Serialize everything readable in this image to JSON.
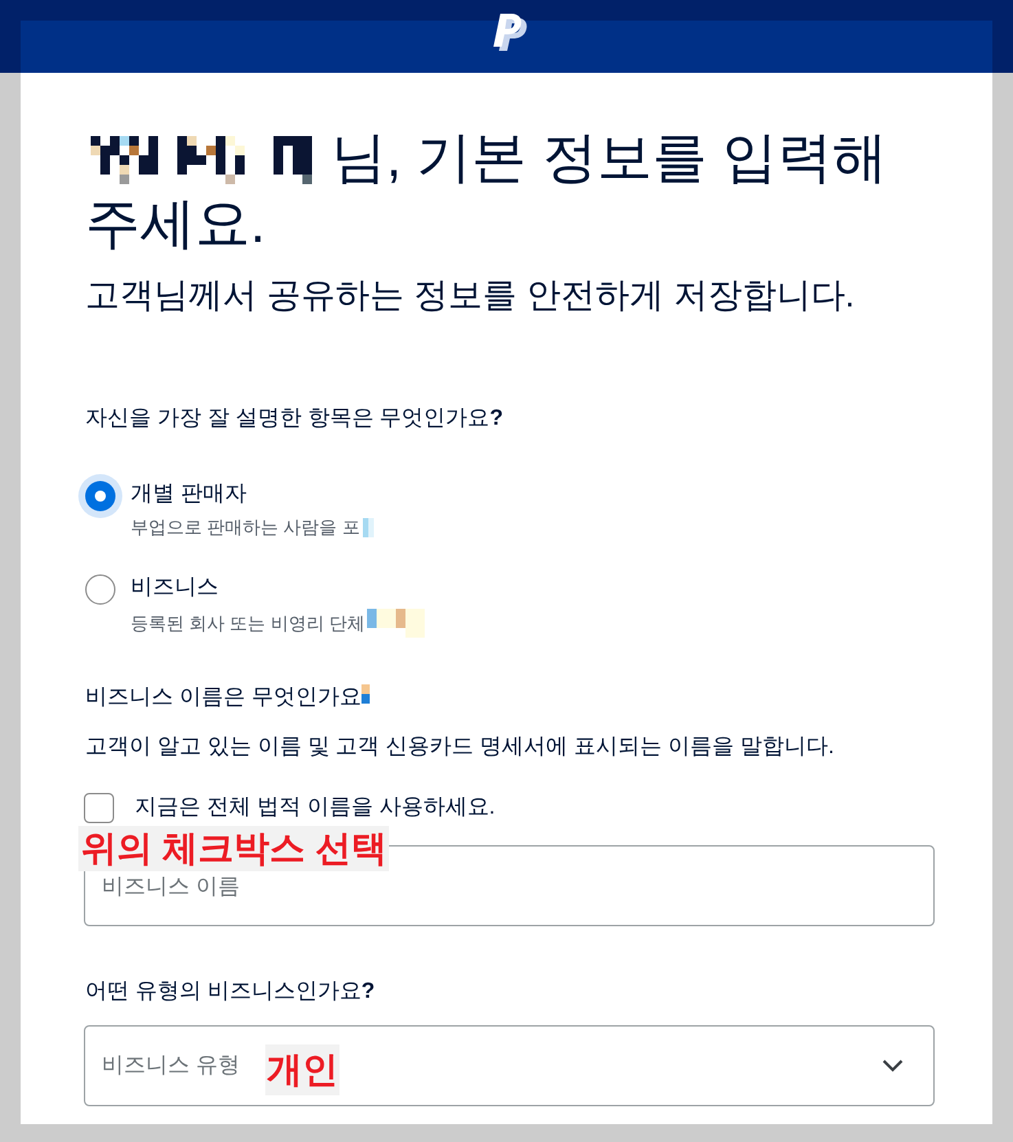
{
  "heading": {
    "name_redacted": true,
    "title": "님, 기본 정보를 입력해 주세요.",
    "subtitle": "고객님께서 공유하는 정보를 안전하게 저장합니다."
  },
  "seller_type": {
    "question": "자신을 가장 잘 설명한 항목은 무엇인가요**?**",
    "options": [
      {
        "label": "개별 판매자",
        "description": "부업으로 판매하는 사람을 포",
        "redacted": true,
        "selected": true
      },
      {
        "label": "비즈니스",
        "description": "등록된 회사 또는 비영리 단체",
        "redacted": true,
        "selected": false
      }
    ]
  },
  "business_name": {
    "question": "비즈니스 이름은 무엇인가요",
    "redacted": true,
    "hint": "고객이 알고 있는 이름 및 고객 신용카드 명세서에 표시되는 이름을 말합니다.",
    "checkbox": {
      "label": "지금은 전체 법적 이름을 사용하세요.",
      "checked": false
    },
    "annotation": "위의 체크박스 선택",
    "field": {
      "placeholder": "비즈니스 이름"
    }
  },
  "business_type": {
    "question": "어떤 유형의 비즈니스인가요**?**",
    "select": {
      "label": "비즈니스 유형"
    },
    "annotation": "개인"
  }
}
